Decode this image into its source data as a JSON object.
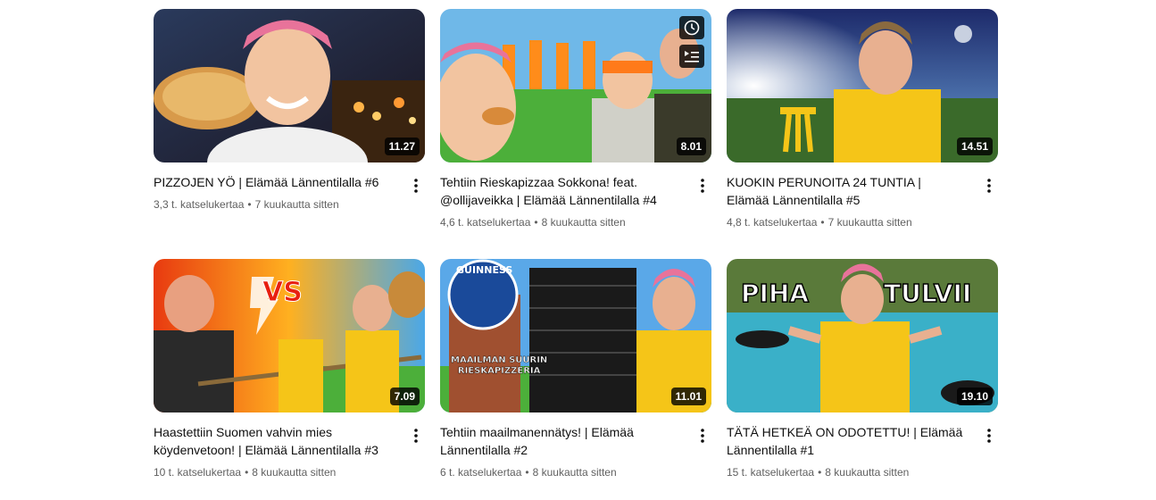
{
  "videos": [
    {
      "title": "PIZZOJEN YÖ | Elämää Lännentilalla #6",
      "duration": "11.27",
      "views": "3,3 t. katselukertaa",
      "age": "7 kuukautta sitten",
      "thumb_icon": "pizza-night-thumbnail"
    },
    {
      "title": "Tehtiin Rieskapizzaa Sokkona! feat. @ollijaveikka | Elämää Lännentilalla #4",
      "duration": "8.01",
      "views": "4,6 t. katselukertaa",
      "age": "8 kuukautta sitten",
      "thumb_icon": "blindfold-pizza-thumbnail"
    },
    {
      "title": "KUOKIN PERUNOITA 24 TUNTIA | Elämää Lännentilalla #5",
      "duration": "14.51",
      "views": "4,8 t. katselukertaa",
      "age": "7 kuukautta sitten",
      "thumb_icon": "potato-field-thumbnail"
    },
    {
      "title": "Haastettiin Suomen vahvin mies köydenvetoon! | Elämää Lännentilalla #3",
      "duration": "7.09",
      "views": "10 t. katselukertaa",
      "age": "8 kuukautta sitten",
      "thumb_icon": "tug-of-war-thumbnail"
    },
    {
      "title": "Tehtiin maailmanennätys! | Elämää Lännentilalla #2",
      "duration": "11.01",
      "views": "6 t. katselukertaa",
      "age": "8 kuukautta sitten",
      "thumb_icon": "world-record-thumbnail"
    },
    {
      "title": "TÄTÄ HETKEÄ ON ODOTETTU! | Elämää Lännentilalla #1",
      "duration": "19.10",
      "views": "15 t. katselukertaa",
      "age": "8 kuukautta sitten",
      "thumb_icon": "flooded-yard-thumbnail"
    }
  ],
  "thumb_overlays": {
    "vs_text": "VS",
    "guinness_text": "GUINNESS",
    "record_caption_1": "MAAILMAN SUURIN",
    "record_caption_2": "RIESKAPIZZERIA",
    "flood_word_1": "PIHA",
    "flood_word_2": "TULVII"
  },
  "hover_icons": [
    "watch-later-icon",
    "add-to-queue-icon"
  ],
  "colors": {
    "title": "#0f0f0f",
    "meta": "#606060",
    "shirt": "#f5c518",
    "duration_bg": "#000000"
  }
}
